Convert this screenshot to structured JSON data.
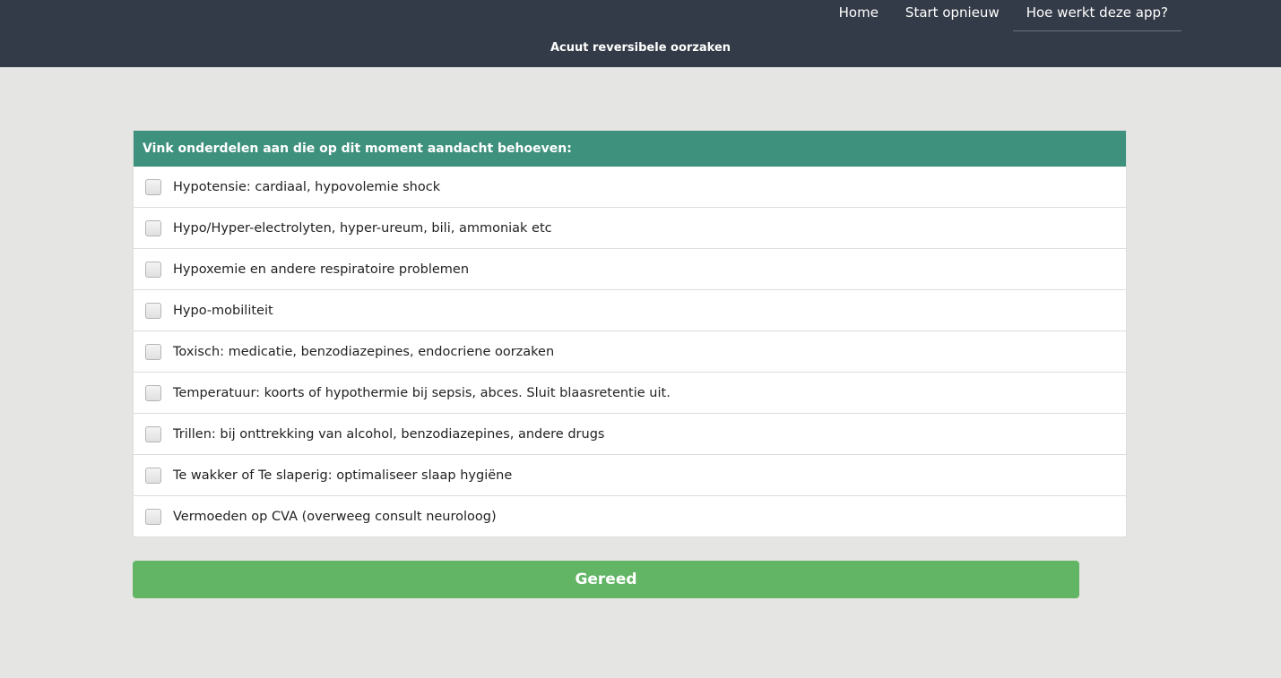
{
  "nav": {
    "items": [
      {
        "label": "Home"
      },
      {
        "label": "Start opnieuw"
      },
      {
        "label": "Hoe werkt deze app?"
      }
    ]
  },
  "header": {
    "subtitle": "Acuut reversibele oorzaken"
  },
  "checklist": {
    "title": "Vink onderdelen aan die op dit moment aandacht behoeven:",
    "items": [
      {
        "label": "Hypotensie: cardiaal, hypovolemie shock",
        "checked": false
      },
      {
        "label": "Hypo/Hyper-electrolyten, hyper-ureum, bili, ammoniak etc",
        "checked": false
      },
      {
        "label": "Hypoxemie en andere respiratoire problemen",
        "checked": false
      },
      {
        "label": "Hypo-mobiliteit",
        "checked": false
      },
      {
        "label": "Toxisch: medicatie, benzodiazepines, endocriene oorzaken",
        "checked": false
      },
      {
        "label": "Temperatuur: koorts of hypothermie bij sepsis, abces. Sluit blaasretentie uit.",
        "checked": false
      },
      {
        "label": "Trillen: bij onttrekking van alcohol, benzodiazepines, andere drugs",
        "checked": false
      },
      {
        "label": "Te wakker of Te slaperig: optimaliseer slaap hygiëne",
        "checked": false
      },
      {
        "label": "Vermoeden op CVA (overweeg consult neuroloog)",
        "checked": false
      }
    ]
  },
  "actions": {
    "done_label": "Gereed"
  },
  "colors": {
    "topbar": "#343b48",
    "panel_header": "#3e917d",
    "done_button": "#62b565",
    "page_background": "#e5e5e3"
  }
}
